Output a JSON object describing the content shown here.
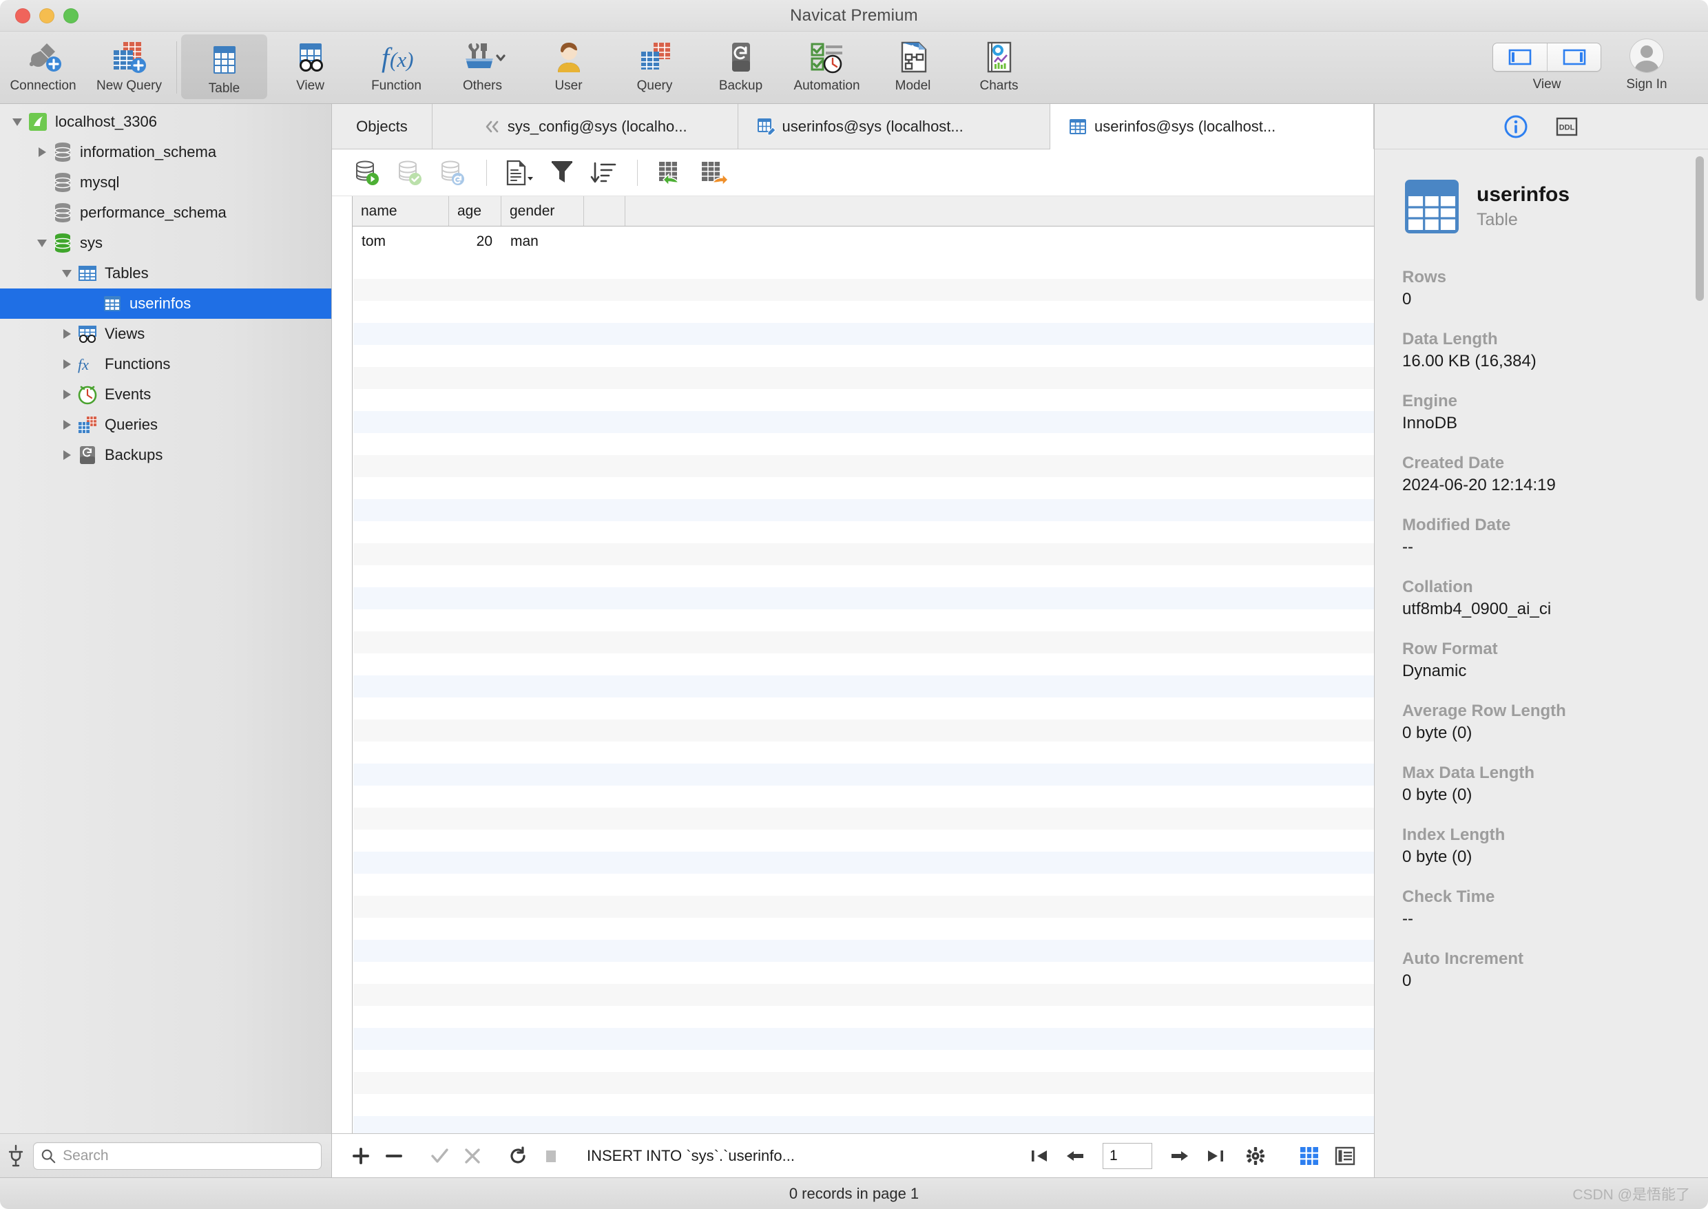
{
  "window": {
    "title": "Navicat Premium"
  },
  "toolbar": {
    "items": [
      {
        "label": "Connection",
        "icon": "connection-plug-icon"
      },
      {
        "label": "New Query",
        "icon": "new-query-icon"
      },
      {
        "label": "Table",
        "icon": "table-icon",
        "selected": true
      },
      {
        "label": "View",
        "icon": "view-glasses-icon"
      },
      {
        "label": "Function",
        "icon": "function-fx-icon"
      },
      {
        "label": "Others",
        "icon": "others-tools-icon"
      },
      {
        "label": "User",
        "icon": "user-avatar-icon"
      },
      {
        "label": "Query",
        "icon": "query-tables-icon"
      },
      {
        "label": "Backup",
        "icon": "backup-restore-icon"
      },
      {
        "label": "Automation",
        "icon": "automation-clock-icon"
      },
      {
        "label": "Model",
        "icon": "model-diagram-icon"
      },
      {
        "label": "Charts",
        "icon": "charts-report-icon"
      }
    ],
    "view_label": "View",
    "signin_label": "Sign In"
  },
  "sidebar": {
    "items": [
      {
        "label": "localhost_3306",
        "depth": 0,
        "twisty": "down",
        "icon": "navicat-connection-icon",
        "selected": false
      },
      {
        "label": "information_schema",
        "depth": 1,
        "twisty": "right",
        "icon": "database-gray-icon",
        "selected": false
      },
      {
        "label": "mysql",
        "depth": 1,
        "twisty": "none",
        "icon": "database-gray-icon",
        "selected": false
      },
      {
        "label": "performance_schema",
        "depth": 1,
        "twisty": "none",
        "icon": "database-gray-icon",
        "selected": false
      },
      {
        "label": "sys",
        "depth": 1,
        "twisty": "down",
        "icon": "database-green-icon",
        "selected": false
      },
      {
        "label": "Tables",
        "depth": 2,
        "twisty": "down",
        "icon": "tables-folder-icon",
        "selected": false
      },
      {
        "label": "userinfos",
        "depth": 3,
        "twisty": "none",
        "icon": "table-blue-icon",
        "selected": true
      },
      {
        "label": "Views",
        "depth": 2,
        "twisty": "right",
        "icon": "views-glasses-icon",
        "selected": false
      },
      {
        "label": "Functions",
        "depth": 2,
        "twisty": "right",
        "icon": "functions-fx-icon",
        "selected": false
      },
      {
        "label": "Events",
        "depth": 2,
        "twisty": "right",
        "icon": "events-clock-icon",
        "selected": false
      },
      {
        "label": "Queries",
        "depth": 2,
        "twisty": "right",
        "icon": "queries-icon",
        "selected": false
      },
      {
        "label": "Backups",
        "depth": 2,
        "twisty": "right",
        "icon": "backups-icon",
        "selected": false
      }
    ],
    "search_placeholder": "Search",
    "connect_icon": "connect-plug-icon"
  },
  "tabs": [
    {
      "label": "Objects",
      "icon": "none",
      "active": false
    },
    {
      "label": "sys_config@sys (localho...",
      "icon": "collapse-chevrons-icon",
      "active": false
    },
    {
      "label": "userinfos@sys (localhost...",
      "icon": "table-edit-icon",
      "active": false
    },
    {
      "label": "userinfos@sys (localhost...",
      "icon": "table-blue-icon",
      "active": true
    }
  ],
  "grid_toolbar": [
    {
      "name": "begin-transaction-icon"
    },
    {
      "name": "commit-icon"
    },
    {
      "name": "rollback-icon"
    },
    {
      "name": "view-form-icon"
    },
    {
      "name": "filter-icon"
    },
    {
      "name": "sort-icon"
    },
    {
      "name": "import-wizard-icon"
    },
    {
      "name": "export-wizard-icon"
    }
  ],
  "grid": {
    "columns": [
      {
        "name": "name",
        "width": 140,
        "align": "left"
      },
      {
        "name": "age",
        "width": 76,
        "align": "right"
      },
      {
        "name": "gender",
        "width": 120,
        "align": "left"
      },
      {
        "name": "",
        "width": 60,
        "align": "left"
      }
    ],
    "rows": [
      {
        "name": "tom",
        "age": "20",
        "gender": "man"
      }
    ]
  },
  "bottombar": {
    "add_icon": "plus-icon",
    "delete_icon": "minus-icon",
    "apply_icon": "check-icon",
    "cancel_icon": "cross-icon",
    "refresh_icon": "refresh-icon",
    "stop_icon": "stop-icon",
    "sql_preview": "INSERT INTO `sys`.`userinfo...",
    "page_value": "1",
    "first_icon": "first-page-icon",
    "prev_icon": "prev-page-icon",
    "next_icon": "next-page-icon",
    "last_icon": "last-page-icon",
    "settings_icon": "gear-icon",
    "grid_view_icon": "grid-view-icon",
    "form_view_icon": "form-view-icon"
  },
  "info_panel": {
    "tab_info_icon": "info-circle-icon",
    "tab_ddl_icon": "ddl-icon",
    "object_name": "userinfos",
    "object_type": "Table",
    "fields": [
      {
        "label": "Rows",
        "value": "0"
      },
      {
        "label": "Data Length",
        "value": "16.00 KB (16,384)"
      },
      {
        "label": "Engine",
        "value": "InnoDB"
      },
      {
        "label": "Created Date",
        "value": "2024-06-20 12:14:19"
      },
      {
        "label": "Modified Date",
        "value": "--"
      },
      {
        "label": "Collation",
        "value": "utf8mb4_0900_ai_ci"
      },
      {
        "label": "Row Format",
        "value": "Dynamic"
      },
      {
        "label": "Average Row Length",
        "value": "0 byte (0)"
      },
      {
        "label": "Max Data Length",
        "value": "0 byte (0)"
      },
      {
        "label": "Index Length",
        "value": "0 byte (0)"
      },
      {
        "label": "Check Time",
        "value": "--"
      },
      {
        "label": "Auto Increment",
        "value": "0"
      }
    ]
  },
  "statusbar": {
    "text": "0 records in page 1",
    "watermark": "CSDN @是悟能了"
  },
  "colors": {
    "selection_blue": "#1f6fe5",
    "accent_blue": "#3d7ebf",
    "green": "#5fb347",
    "orange": "#d8614a"
  }
}
